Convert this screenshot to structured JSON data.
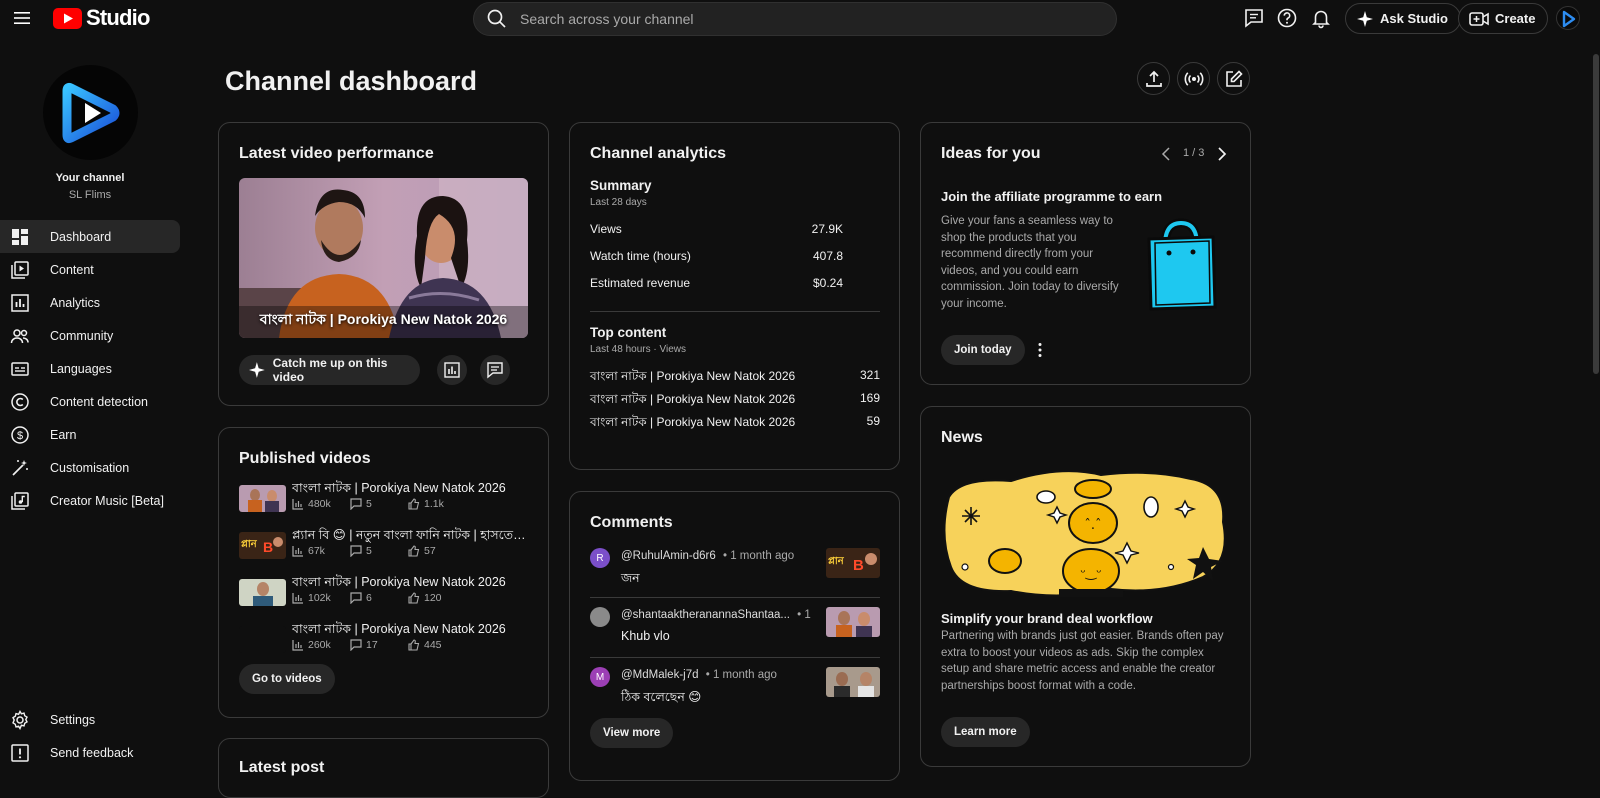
{
  "header": {
    "logo_text": "Studio",
    "search_placeholder": "Search across your channel",
    "ask_studio_label": "Ask Studio",
    "create_label": "Create"
  },
  "sidebar": {
    "channel_label": "Your channel",
    "channel_name": "SL Flims",
    "items": [
      {
        "label": "Dashboard",
        "icon": "dashboard-icon",
        "active": true
      },
      {
        "label": "Content",
        "icon": "content-icon"
      },
      {
        "label": "Analytics",
        "icon": "analytics-icon"
      },
      {
        "label": "Community",
        "icon": "community-icon"
      },
      {
        "label": "Languages",
        "icon": "languages-icon"
      },
      {
        "label": "Content detection",
        "icon": "copyright-icon"
      },
      {
        "label": "Earn",
        "icon": "earn-icon"
      },
      {
        "label": "Customisation",
        "icon": "customisation-icon"
      },
      {
        "label": "Creator Music [Beta]",
        "icon": "music-icon"
      }
    ],
    "settings_label": "Settings",
    "feedback_label": "Send feedback"
  },
  "main": {
    "page_title": "Channel dashboard",
    "latest_video": {
      "title": "Latest video performance",
      "thumb_caption": "বাংলা নাটক | Porokiya New Natok 2026",
      "catch_up_label": "Catch me up on this video"
    },
    "published": {
      "title": "Published videos",
      "videos": [
        {
          "title": "বাংলা নাটক | Porokiya New Natok 2026",
          "views": "480k",
          "comments": "5",
          "likes": "1.1k"
        },
        {
          "title": "প্ল্যান বি 😊 | নতুন বাংলা ফানি নাটক | হাসতে হাসতে",
          "views": "67k",
          "comments": "5",
          "likes": "57"
        },
        {
          "title": "বাংলা নাটক | Porokiya New Natok 2026",
          "views": "102k",
          "comments": "6",
          "likes": "120"
        },
        {
          "title": "বাংলা নাটক | Porokiya New Natok 2026",
          "views": "260k",
          "comments": "17",
          "likes": "445"
        }
      ],
      "go_to_videos_label": "Go to videos"
    },
    "latest_post": {
      "title": "Latest post"
    },
    "analytics": {
      "title": "Channel analytics",
      "summary_title": "Summary",
      "summary_period": "Last 28 days",
      "metrics": [
        {
          "label": "Views",
          "value": "27.9K"
        },
        {
          "label": "Watch time (hours)",
          "value": "407.8"
        },
        {
          "label": "Estimated revenue",
          "value": "$0.24"
        }
      ],
      "top_title": "Top content",
      "top_period": "Last 48 hours · Views",
      "top_items": [
        {
          "title": "বাংলা নাটক | Porokiya New Natok 2026",
          "value": "321"
        },
        {
          "title": "বাংলা নাটক | Porokiya New Natok 2026",
          "value": "169"
        },
        {
          "title": "বাংলা নাটক | Porokiya New Natok 2026",
          "value": "59"
        }
      ]
    },
    "comments": {
      "title": "Comments",
      "items": [
        {
          "initial": "R",
          "user": "@RuhulAmin-d6r6",
          "time": "• 1 month ago",
          "text": "জন",
          "avatar_color": "#7b4fc9"
        },
        {
          "initial": "",
          "user": "@shantaaktherananna​Shantaa...",
          "time": "• 1",
          "text": "Khub vlo",
          "avatar_color": "#8a8a8a"
        },
        {
          "initial": "M",
          "user": "@MdMalek-j7d",
          "time": "• 1 month ago",
          "text": "ঠিক বলেছেন 😊",
          "avatar_color": "#9c3fb5"
        }
      ],
      "view_more_label": "View more"
    },
    "ideas": {
      "title": "Ideas for you",
      "pager": "1 / 3",
      "headline": "Join the affiliate programme to earn",
      "description": "Give your fans a seamless way to shop the products that you recommend directly from your videos, and you could earn commission. Join today to diversify your income.",
      "join_label": "Join today"
    },
    "news": {
      "title": "News",
      "headline": "Simplify your brand deal workflow",
      "description": "Partnering with brands just got easier. Brands often pay extra to boost your videos as ads. Skip the complex setup and share metric access and enable the creator partnerships boost format with a code.",
      "learn_more_label": "Learn more"
    }
  },
  "colors": {
    "accent_red": "#ff0000",
    "bag_blue": "#1ec8f0",
    "news_yellow": "#f7d25a"
  }
}
